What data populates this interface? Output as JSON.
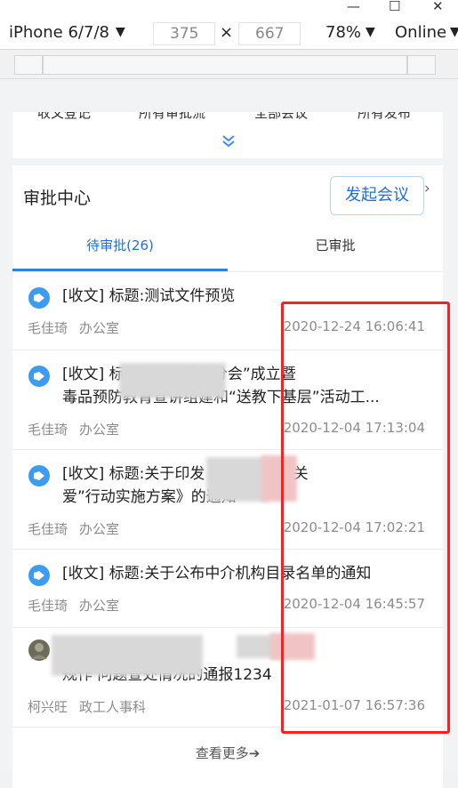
{
  "window": {
    "minimize": "—",
    "maximize": "☐",
    "close": "✕"
  },
  "device_toolbar": {
    "device": "iPhone 6/7/8",
    "width": "375",
    "times": "×",
    "height": "667",
    "zoom": "78%",
    "network": "Online",
    "dropdown_caret": "▼"
  },
  "shortcuts": {
    "labels": [
      "收文登记",
      "所有审批流",
      "全部会议",
      "所有发布"
    ],
    "expand_icon": "double-chevron-down-icon"
  },
  "approval": {
    "title": "审批中心",
    "start_button": "发起会议",
    "chevron": "›",
    "tabs": [
      {
        "label": "待审批(26)",
        "active": true
      },
      {
        "label": "已审批",
        "active": false
      }
    ],
    "items": [
      {
        "line1": "[收文] 标题:测试文件预览",
        "line2": "",
        "sender": "毛佳琦",
        "dept": "办公室",
        "time": "2020-12-24 16:06:41"
      },
      {
        "line1": "[收文] 标                          开“五个禁毒分会”成立暨",
        "line2": "毒品预防教育宣讲组建和“送教下基层”活动工...",
        "sender": "毛佳琦",
        "dept": "办公室",
        "time": "2020-12-04 17:13:04"
      },
      {
        "line1": "[收文] 标题:关于印发                   毒人员“平安关",
        "line2": "爱”行动实施方案》的通知",
        "sender": "毛佳琦",
        "dept": "办公室",
        "time": "2020-12-04 17:02:21"
      },
      {
        "line1": "[收文] 标题:关于公布中介机构目录名单的通知",
        "line2": "",
        "sender": "毛佳琦",
        "dept": "办公室",
        "time": "2020-12-04 16:45:57"
      },
      {
        "line1": "                              题:关                 3名同志违",
        "line2": "规作      问题查处情况的通报1234",
        "sender": "柯兴旺",
        "dept": "政工人事科",
        "time": "2021-01-07 16:57:36"
      }
    ],
    "more": "查看更多➔"
  },
  "colors": {
    "accent": "#1f6fd6",
    "highlight_box": "#ff1f1f"
  }
}
